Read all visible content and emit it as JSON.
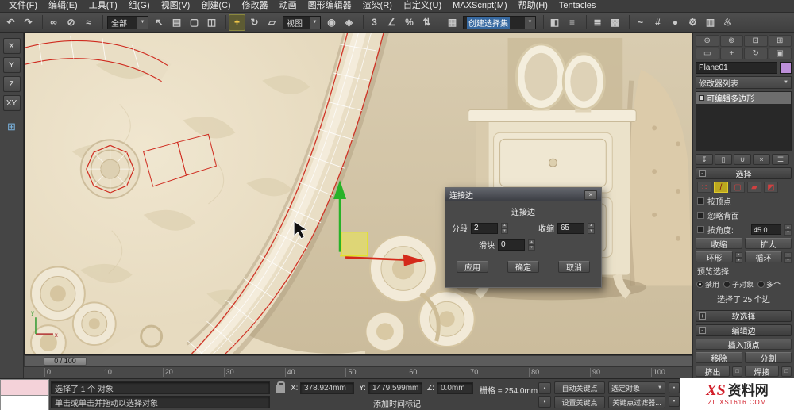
{
  "icons": {
    "dropdown": "▼",
    "spinner_up": "▴",
    "spinner_down": "▾",
    "settings_box": "□",
    "close": "×",
    "plus": "+",
    "minus": "-",
    "bullet": "•"
  },
  "menu_bar": {
    "items": [
      "文件(F)",
      "编辑(E)",
      "工具(T)",
      "组(G)",
      "视图(V)",
      "创建(C)",
      "修改器",
      "动画",
      "图形编辑器",
      "渲染(R)",
      "自定义(U)",
      "MAXScript(M)",
      "帮助(H)",
      "Tentacles"
    ]
  },
  "toolbar": {
    "items": [
      {
        "name": "undo-icon",
        "glyph": "↶"
      },
      {
        "name": "redo-icon",
        "glyph": "↷"
      },
      {
        "type": "sep"
      },
      {
        "name": "select-and-link-icon",
        "glyph": "∞"
      },
      {
        "name": "unlink-selection-icon",
        "glyph": "⊘"
      },
      {
        "name": "bind-to-space-warp-icon",
        "glyph": "≈"
      },
      {
        "type": "sep"
      },
      {
        "name": "selection-filter-dropdown",
        "type": "select",
        "value": "全部"
      },
      {
        "name": "select-object-icon",
        "glyph": "↖"
      },
      {
        "name": "select-by-name-icon",
        "glyph": "▤"
      },
      {
        "name": "selection-region-icon",
        "glyph": "▢"
      },
      {
        "name": "window-crossing-icon",
        "glyph": "◫"
      },
      {
        "type": "sep"
      },
      {
        "name": "select-and-move-icon",
        "glyph": "+",
        "active": true
      },
      {
        "name": "select-and-rotate-icon",
        "glyph": "↻"
      },
      {
        "name": "select-and-scale-icon",
        "glyph": "▱"
      },
      {
        "name": "ref-coord-dropdown",
        "type": "select",
        "value": "视图"
      },
      {
        "name": "use-pivot-center-icon",
        "glyph": "◉"
      },
      {
        "name": "select-and-manipulate-icon",
        "glyph": "◈"
      },
      {
        "type": "sep"
      },
      {
        "name": "snap-toggle-icon",
        "glyph": "3"
      },
      {
        "name": "angle-snap-icon",
        "glyph": "∠"
      },
      {
        "name": "percent-snap-icon",
        "glyph": "%"
      },
      {
        "name": "spinner-snap-icon",
        "glyph": "⇅"
      },
      {
        "type": "sep"
      },
      {
        "name": "edit-named-selection-sets-icon",
        "glyph": "▦"
      },
      {
        "name": "named-selection-dropdown",
        "type": "select",
        "value": "创建选择集",
        "highlight": true
      },
      {
        "type": "sep"
      },
      {
        "name": "mirror-icon",
        "glyph": "◧"
      },
      {
        "name": "align-icon",
        "glyph": "≡"
      },
      {
        "type": "sep"
      },
      {
        "name": "layer-manager-icon",
        "glyph": "≣"
      },
      {
        "name": "graphite-ribbon-icon",
        "glyph": "▩"
      },
      {
        "type": "sep"
      },
      {
        "name": "curve-editor-icon",
        "glyph": "~"
      },
      {
        "name": "schematic-view-icon",
        "glyph": "#"
      },
      {
        "name": "material-editor-icon",
        "glyph": "●"
      },
      {
        "name": "render-setup-icon",
        "glyph": "⚙"
      },
      {
        "name": "rendered-frame-icon",
        "glyph": "▥"
      },
      {
        "name": "render-production-icon",
        "glyph": "♨"
      }
    ]
  },
  "axis_constraints": {
    "buttons": [
      "X",
      "Y",
      "Z",
      "XY"
    ],
    "icon_glyph": "⊞"
  },
  "viewport": {
    "gizmo_x_color": "#d42a1a",
    "gizmo_y_color": "#28b228",
    "plane_handle_color": "#f0f040",
    "selected_edge_color": "#cf2a1e"
  },
  "dialog": {
    "title": "连接边",
    "group_label": "连接边",
    "segments_label": "分段",
    "segments_value": "2",
    "pinch_label": "收缩",
    "pinch_value": "65",
    "slide_label": "滑块",
    "slide_value": "0",
    "apply": "应用",
    "ok": "确定",
    "cancel": "取消"
  },
  "command_panel": {
    "nav_icons": [
      {
        "name": "zoom-icon",
        "glyph": "⊕"
      },
      {
        "name": "zoom-all-icon",
        "glyph": "⊚"
      },
      {
        "name": "zoom-extents-icon",
        "glyph": "⊡"
      },
      {
        "name": "zoom-extents-all-icon",
        "glyph": "⊞"
      },
      {
        "name": "field-of-view-icon",
        "glyph": "▭"
      },
      {
        "name": "pan-view-icon",
        "glyph": "+"
      },
      {
        "name": "orbit-icon",
        "glyph": "↻"
      },
      {
        "name": "maximize-viewport-icon",
        "glyph": "▣"
      }
    ],
    "object_name": "Plane01",
    "object_color": "#bd8fd9",
    "modifier_list_label": "修改器列表",
    "stack_items": [
      {
        "label": "可编辑多边形",
        "selected": true
      }
    ],
    "stack_tools": [
      {
        "name": "pin-stack-icon",
        "glyph": "↧"
      },
      {
        "name": "show-end-result-icon",
        "glyph": "▯"
      },
      {
        "name": "make-unique-icon",
        "glyph": "∪"
      },
      {
        "name": "remove-modifier-icon",
        "glyph": "×"
      },
      {
        "name": "configure-modifier-sets-icon",
        "glyph": "☰"
      }
    ],
    "selection": {
      "title": "选择",
      "subobject_icons": [
        {
          "name": "vertex-subobject-icon",
          "glyph": "∷"
        },
        {
          "name": "edge-subobject-icon",
          "glyph": "/",
          "active": true
        },
        {
          "name": "border-subobject-icon",
          "glyph": "▢"
        },
        {
          "name": "polygon-subobject-icon",
          "glyph": "▰"
        },
        {
          "name": "element-subobject-icon",
          "glyph": "◩"
        }
      ],
      "by_vertex": "按顶点",
      "ignore_backfacing": "忽略背面",
      "by_angle": "按角度:",
      "by_angle_value": "45.0",
      "shrink": "收缩",
      "grow": "扩大",
      "ring": "环形",
      "loop": "循环",
      "preview_label": "预览选择",
      "preview_options": [
        {
          "label": "禁用",
          "on": true
        },
        {
          "label": "子对象",
          "on": false
        },
        {
          "label": "多个",
          "on": false
        }
      ],
      "count_text": "选择了 25 个边"
    },
    "soft_selection_title": "软选择",
    "edit_edges_title": "编辑边",
    "edit_buttons": {
      "insert_vertex": "插入顶点",
      "remove": "移除",
      "split": "分割",
      "extrude": "挤出",
      "weld": "焊接"
    }
  },
  "timeline": {
    "slider_label": "0 / 100",
    "ticks": [
      "0",
      "10",
      "20",
      "30",
      "40",
      "50",
      "60",
      "70",
      "80",
      "90",
      "100"
    ]
  },
  "status_bar": {
    "selection_status": "选择了 1 个 对象",
    "prompt": "单击或单击并拖动以选择对象",
    "x_label": "X:",
    "x_value": "378.924mm",
    "y_label": "Y:",
    "y_value": "1479.599mm",
    "z_label": "Z:",
    "z_value": "0.0mm",
    "grid_label": "栅格 = 254.0mm",
    "time_tag": "添加时间标记",
    "auto_key": "自动关键点",
    "selected_filter": "选定对象",
    "set_key": "设置关键点",
    "key_filters": "关键点过滤器..."
  },
  "watermark": {
    "logo": "XS",
    "text": "资料网",
    "url": "ZL.XS1616.COM",
    "accent_color": "#d21f2a"
  }
}
